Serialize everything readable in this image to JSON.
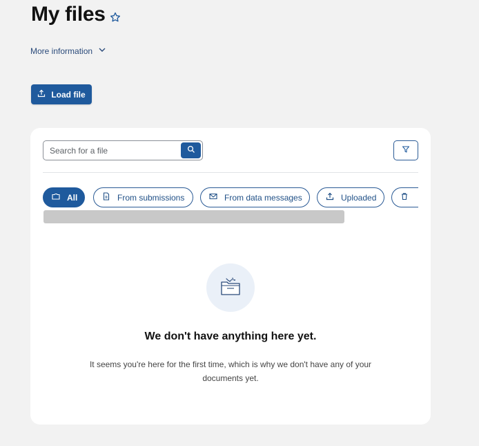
{
  "header": {
    "title": "My files",
    "more_info_label": "More information"
  },
  "toolbar": {
    "load_file_label": "Load file"
  },
  "search": {
    "placeholder": "Search for a file"
  },
  "filters": [
    {
      "label": "All",
      "icon": "folder-icon",
      "active": true
    },
    {
      "label": "From submissions",
      "icon": "document-icon",
      "active": false
    },
    {
      "label": "From data messages",
      "icon": "mail-icon",
      "active": false
    },
    {
      "label": "Uploaded",
      "icon": "upload-icon",
      "active": false
    },
    {
      "label": "",
      "icon": "trash-icon",
      "active": false
    }
  ],
  "empty_state": {
    "icon": "empty-folder-icon",
    "title": "We don't have anything here yet.",
    "text": "It seems you're here for the first time, which is why we don't have any of your documents yet."
  },
  "colors": {
    "accent": "#1f5a9d",
    "page_bg": "#f2f2f2",
    "card_bg": "#ffffff"
  }
}
